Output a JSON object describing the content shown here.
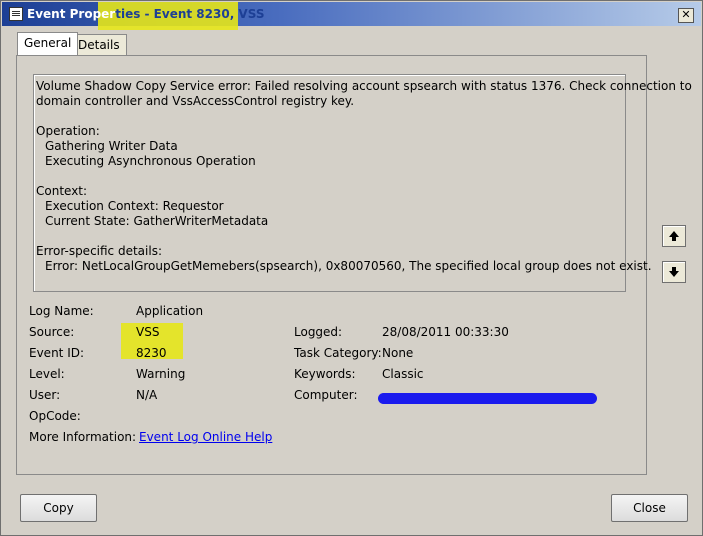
{
  "window": {
    "title_prefix": "Event Proper",
    "title_rest": "ties - Event 8230, VSS",
    "close_glyph": "✕"
  },
  "tabs": [
    {
      "label": "General",
      "active": true
    },
    {
      "label": "Details",
      "active": false
    }
  ],
  "description": {
    "lines": [
      "Volume Shadow Copy Service error: Failed resolving account spsearch with status 1376. Check connection to",
      "domain controller and VssAccessControl registry key.",
      "Operation:",
      "Gathering Writer Data",
      "Executing Asynchronous Operation",
      "Context:",
      "Execution Context: Requestor",
      "Current State: GatherWriterMetadata",
      "Error-specific details:",
      "Error: NetLocalGroupGetMemebers(spsearch), 0x80070560, The specified local group does not exist."
    ]
  },
  "fields": {
    "log_name_label": "Log Name:",
    "log_name_value": "Application",
    "source_label": "Source:",
    "source_value": "VSS",
    "event_id_label": "Event ID:",
    "event_id_value": "8230",
    "level_label": "Level:",
    "level_value": "Warning",
    "user_label": "User:",
    "user_value": "N/A",
    "opcode_label": "OpCode:",
    "more_info_label": "More Information:",
    "more_info_link": "Event Log Online Help",
    "logged_label": "Logged:",
    "logged_value": "28/08/2011 00:33:30",
    "task_category_label": "Task Category:",
    "task_category_value": "None",
    "keywords_label": "Keywords:",
    "keywords_value": "Classic",
    "computer_label": "Computer:"
  },
  "buttons": {
    "copy": "Copy",
    "close": "Close"
  },
  "colors": {
    "highlight": "#e6e51a",
    "redaction": "#1a1aee",
    "link": "#0000ee"
  },
  "icons": [
    "event-properties-icon",
    "close-icon",
    "arrow-up-icon",
    "arrow-down-icon"
  ]
}
